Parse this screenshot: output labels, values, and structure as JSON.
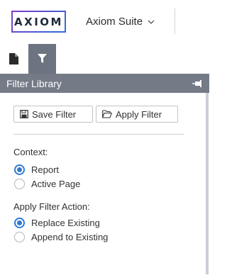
{
  "header": {
    "logo_text": "AXIOM",
    "suite_label": "Axiom Suite"
  },
  "tabs": [
    {
      "name": "document-tab",
      "icon": "document-icon"
    },
    {
      "name": "filter-tab",
      "icon": "filter-icon",
      "active": true
    }
  ],
  "panel": {
    "title": "Filter Library",
    "pin_icon": "pin-icon"
  },
  "toolbar": {
    "save_label": "Save Filter",
    "apply_label": "Apply Filter"
  },
  "context": {
    "label": "Context:",
    "options": [
      "Report",
      "Active Page"
    ],
    "selected": "Report"
  },
  "apply_action": {
    "label": "Apply Filter Action:",
    "options": [
      "Replace Existing",
      "Append to Existing"
    ],
    "selected": "Replace Existing"
  },
  "colors": {
    "accent": "#2f7bd1",
    "panel_header": "#747b86",
    "active_tab": "#6c7481"
  }
}
